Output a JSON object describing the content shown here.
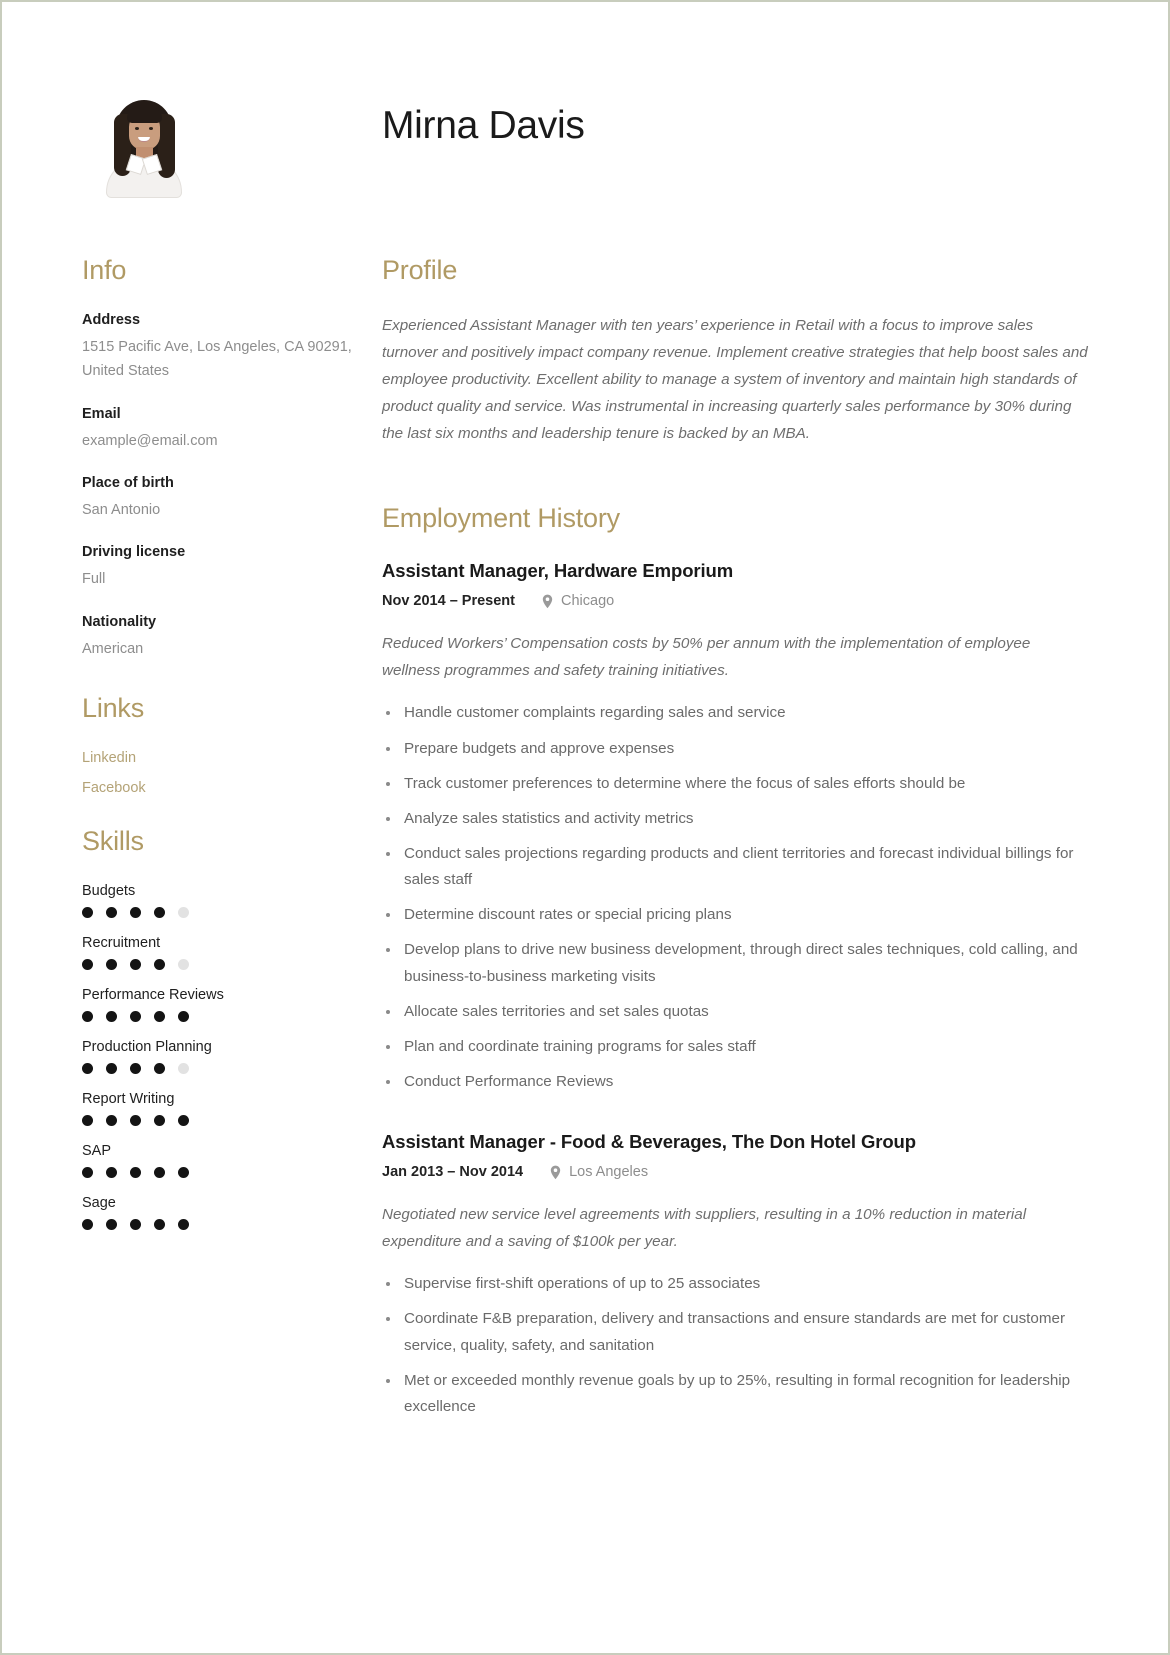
{
  "header": {
    "name": "Mirna Davis",
    "photo_alt": "portrait-photo"
  },
  "sidebar": {
    "info": {
      "title": "Info",
      "fields": [
        {
          "label": "Address",
          "value": "1515 Pacific Ave, Los Angeles, CA 90291, United States"
        },
        {
          "label": "Email",
          "value": "example@email.com"
        },
        {
          "label": "Place of birth",
          "value": "San Antonio"
        },
        {
          "label": "Driving license",
          "value": "Full"
        },
        {
          "label": "Nationality",
          "value": "American"
        }
      ]
    },
    "links": {
      "title": "Links",
      "items": [
        {
          "label": "Linkedin"
        },
        {
          "label": "Facebook"
        }
      ]
    },
    "skills": {
      "title": "Skills",
      "max_rating": 5,
      "items": [
        {
          "name": "Budgets",
          "rating": 4
        },
        {
          "name": "Recruitment",
          "rating": 4
        },
        {
          "name": "Performance Reviews",
          "rating": 5
        },
        {
          "name": "Production Planning",
          "rating": 4
        },
        {
          "name": "Report Writing",
          "rating": 5
        },
        {
          "name": "SAP",
          "rating": 5
        },
        {
          "name": "Sage",
          "rating": 5
        }
      ]
    }
  },
  "main": {
    "profile": {
      "title": "Profile",
      "text": "Experienced Assistant Manager with ten years’ experience in Retail with a focus to improve sales turnover and positively impact company revenue. Implement creative strategies that help boost sales and employee productivity. Excellent ability to manage a system of inventory and maintain high standards of product quality and service. Was instrumental in increasing quarterly sales performance by 30% during the last six months and leadership tenure is backed by an MBA."
    },
    "employment": {
      "title": "Employment History",
      "jobs": [
        {
          "title": "Assistant Manager, Hardware Emporium",
          "dates": "Nov 2014 – Present",
          "location": "Chicago",
          "summary": "Reduced Workers’ Compensation costs by 50% per annum with the implementation of employee wellness programmes and safety training initiatives.",
          "bullets": [
            "Handle customer complaints regarding sales and service",
            "Prepare budgets and approve expenses",
            "Track customer preferences to determine where the focus of sales efforts should be",
            "Analyze sales statistics and activity metrics",
            "Conduct sales projections regarding products and client territories and forecast individual billings for sales staff",
            "Determine discount rates or special pricing plans",
            "Develop plans to drive new business development, through direct sales techniques, cold calling, and business-to-business marketing visits",
            "Allocate sales territories and set sales quotas",
            "Plan and coordinate training programs for sales staff",
            "Conduct Performance Reviews"
          ]
        },
        {
          "title": "Assistant Manager - Food & Beverages, The Don Hotel Group",
          "dates": "Jan 2013 – Nov 2014",
          "location": "Los Angeles",
          "summary": "Negotiated new service level agreements with suppliers, resulting in a 10% reduction in material expenditure and a saving of $100k per year.",
          "bullets": [
            "Supervise first-shift operations of up to 25 associates",
            "Coordinate F&B preparation, delivery and transactions and ensure standards are met for customer service, quality, safety, and sanitation",
            "Met or exceeded monthly revenue goals by up to 25%, resulting in formal recognition for leadership excellence"
          ]
        }
      ]
    }
  },
  "colors": {
    "accent_heading": "#b09a64",
    "link": "#b4a377",
    "body_text": "#6e6e6e",
    "strong_text": "#1a1a1a",
    "muted_text": "#8d8d8d",
    "page_border": "#c8cdbd",
    "dot_filled": "#141414",
    "dot_empty": "#e2e2e2"
  }
}
